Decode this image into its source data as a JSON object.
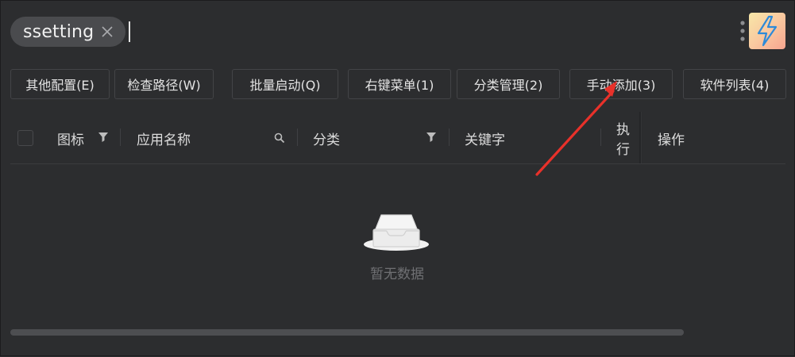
{
  "search": {
    "tag_text": "ssetting"
  },
  "toolbar": {
    "buttons": [
      {
        "label": "其他配置(E)"
      },
      {
        "label": "检查路径(W)"
      },
      {
        "label": "批量启动(Q)"
      },
      {
        "label": "右键菜单(1)"
      },
      {
        "label": "分类管理(2)"
      },
      {
        "label": "手动添加(3)"
      },
      {
        "label": "软件列表(4)"
      }
    ]
  },
  "table": {
    "columns": {
      "icon": "图标",
      "app_name": "应用名称",
      "category": "分类",
      "keyword": "关键字",
      "execute": "执行",
      "actions": "操作"
    },
    "empty_text": "暂无数据"
  },
  "colors": {
    "background": "#2c2d2f",
    "annotation_arrow": "#e8312a"
  }
}
